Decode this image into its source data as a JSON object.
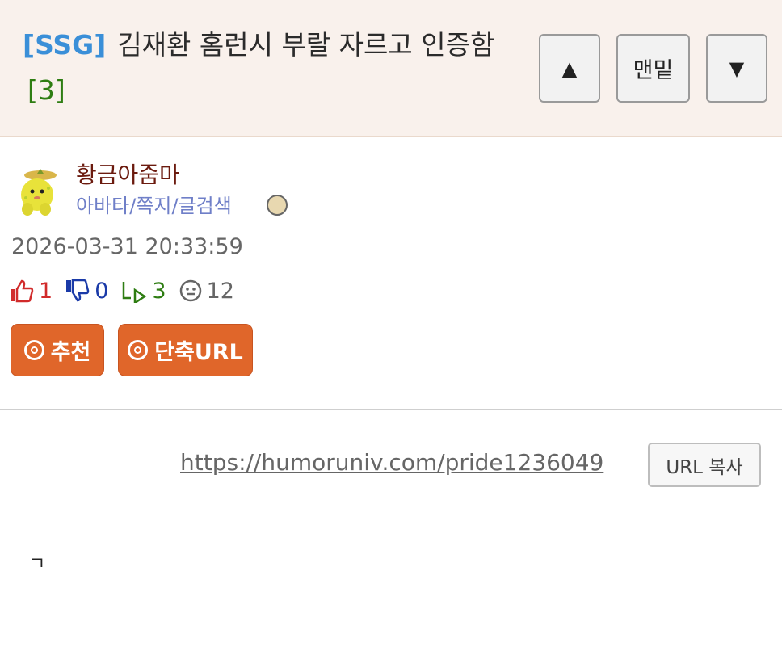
{
  "post": {
    "tag": "[SSG]",
    "title": "김재환 홈런시 부랄 자르고 인증함",
    "comment_count": "[3]"
  },
  "nav": {
    "up_label": "▲",
    "bottom_label": "맨밑",
    "down_label": "▼"
  },
  "author": {
    "name": "황금아줌마",
    "links": "아바타/쪽지/글검색"
  },
  "meta": {
    "datetime": "2026-03-31 20:33:59"
  },
  "stats": {
    "up": "1",
    "down": "0",
    "replies": "3",
    "views": "12"
  },
  "actions": {
    "recommend_label": "추천",
    "short_url_label": "단축URL"
  },
  "url": {
    "link": "https://humoruniv.com/pride1236049",
    "copy_label": "URL 복사"
  },
  "content": {
    "text": "ㄱ"
  },
  "colors": {
    "tag": "#3a8fd8",
    "count": "#2e7d12",
    "header_bg": "#f9f1ec",
    "action_button": "#e0662a",
    "author_name": "#6b1a0e",
    "author_links": "#6f7fc8"
  },
  "icons": {
    "avatar": "yellow-creature-avatar",
    "badge": "badge-icon",
    "thumbs_up": "thumbs-up-icon",
    "thumbs_down": "thumbs-down-icon",
    "reply": "reply-arrow-icon",
    "views": "smiley-icon",
    "recommend": "circle-target-icon",
    "short_url": "circle-u-icon"
  }
}
